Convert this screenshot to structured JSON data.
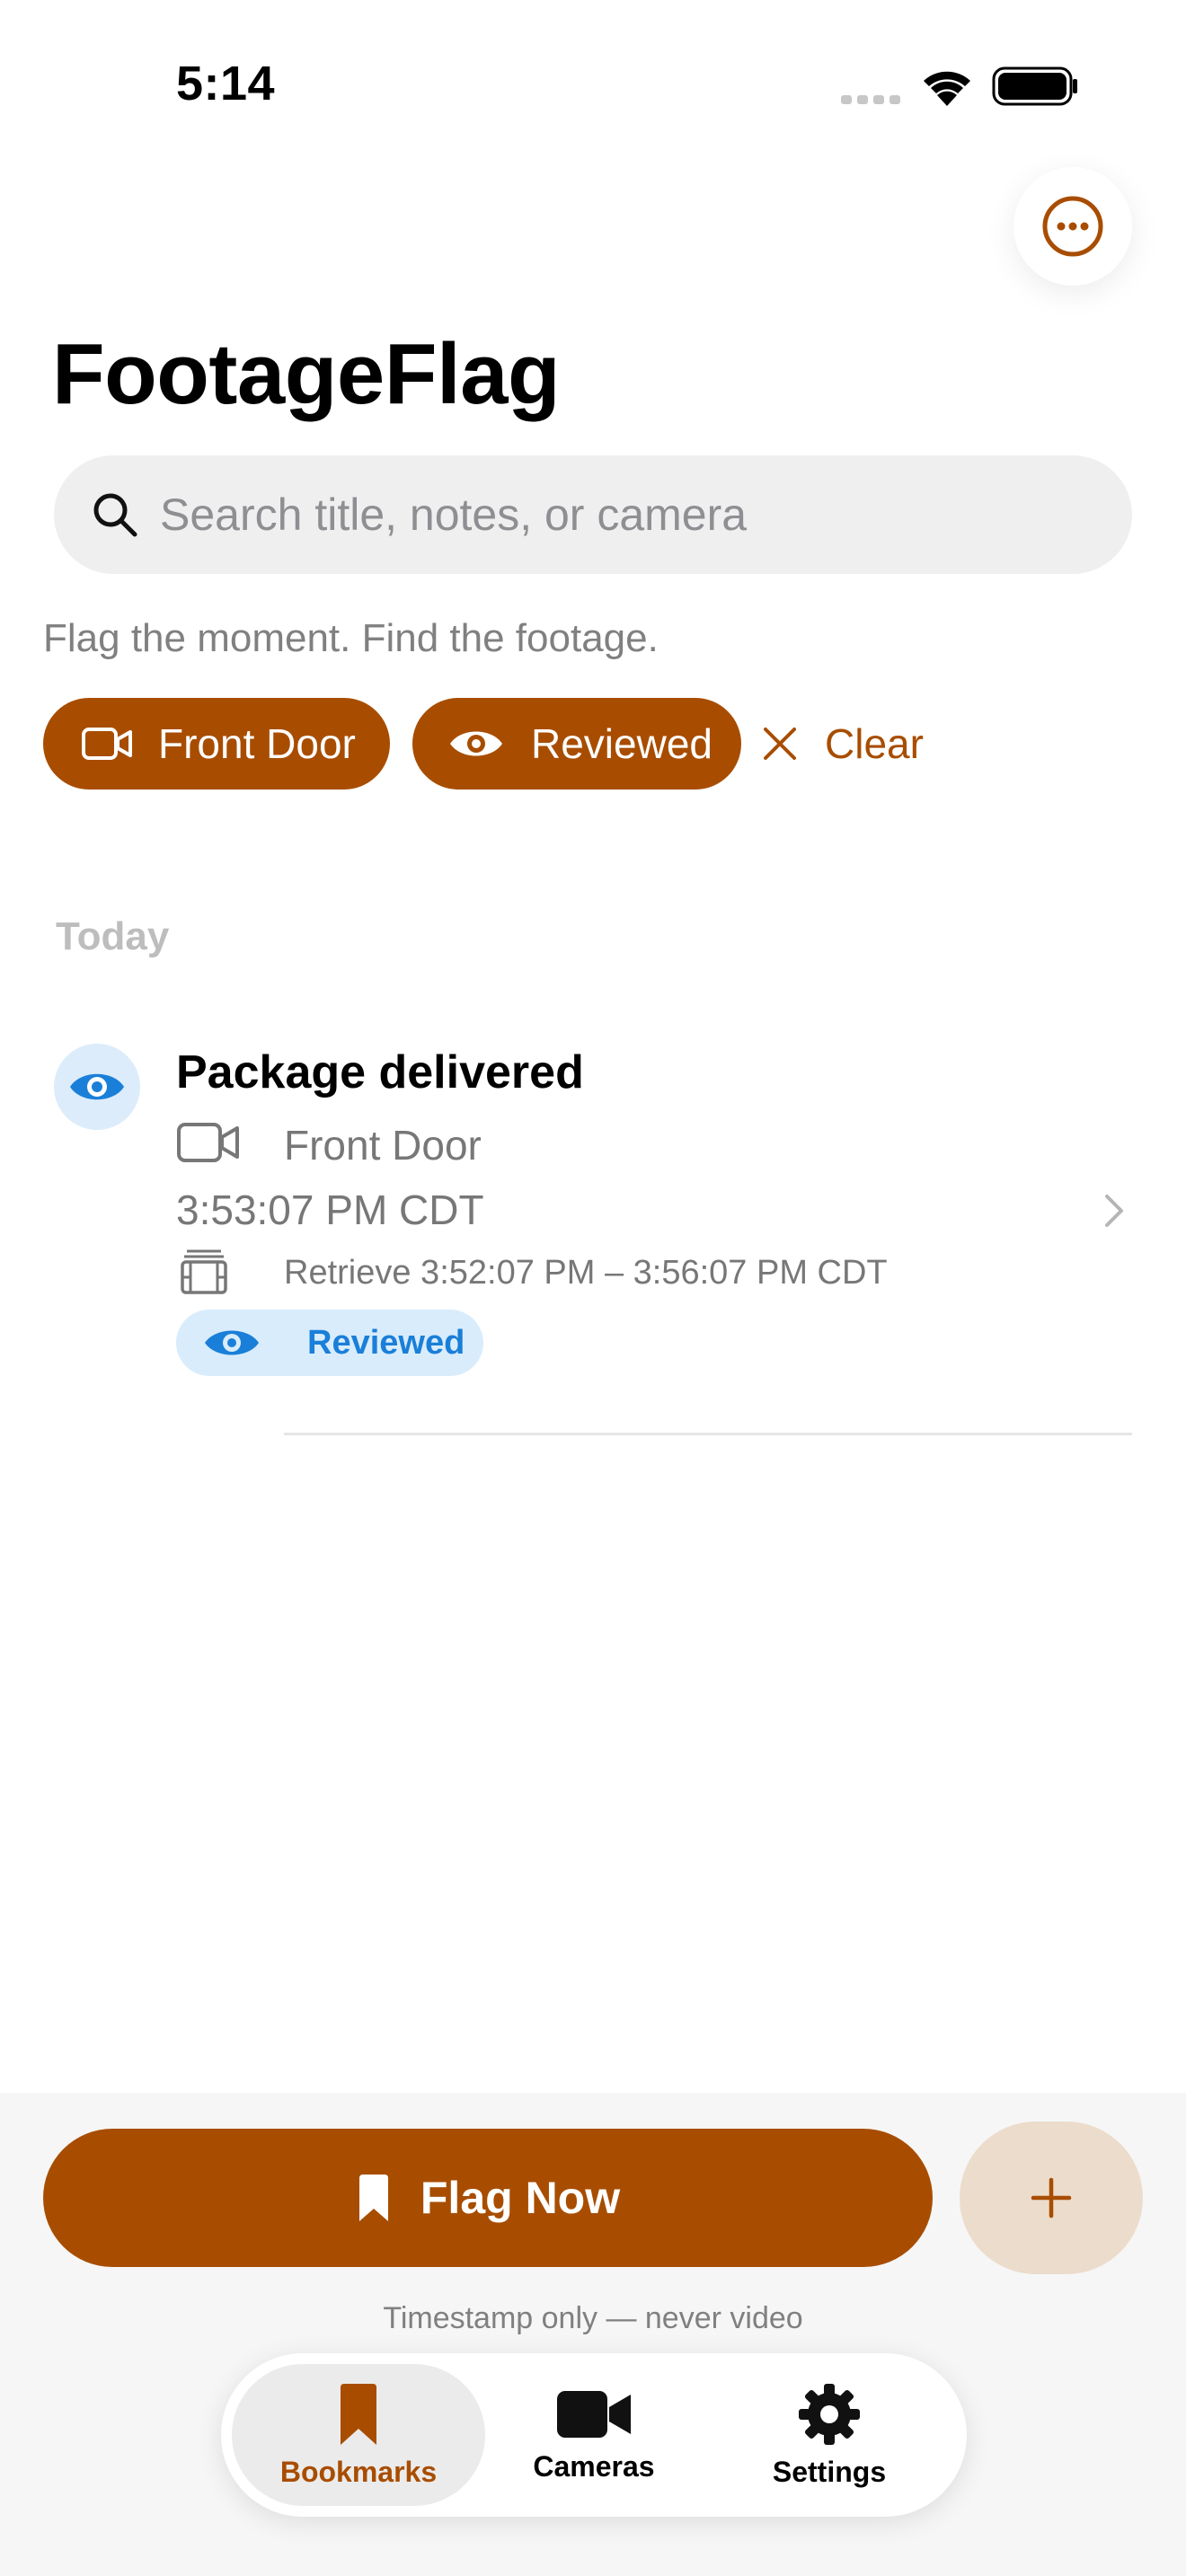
{
  "status_bar": {
    "time": "5:14"
  },
  "app": {
    "title": "FootageFlag",
    "tagline": "Flag the moment. Find the footage."
  },
  "search": {
    "placeholder": "Search title, notes, or camera",
    "value": ""
  },
  "filters": {
    "chips": [
      {
        "label": "Front Door",
        "icon": "video-camera-icon"
      },
      {
        "label": "Reviewed",
        "icon": "eye-icon"
      }
    ],
    "clear_label": "Clear"
  },
  "list": {
    "section_title": "Today",
    "items": [
      {
        "title": "Package delivered",
        "camera": "Front Door",
        "time": "3:53:07 PM CDT",
        "retrieve": "Retrieve 3:52:07 PM – 3:56:07 PM CDT",
        "status": "Reviewed",
        "status_icon": "eye-icon"
      }
    ]
  },
  "actions": {
    "flag_now_label": "Flag Now",
    "add_icon": "plus-icon",
    "footnote": "Timestamp only — never video"
  },
  "tabs": [
    {
      "label": "Bookmarks",
      "icon": "bookmark-icon",
      "active": true
    },
    {
      "label": "Cameras",
      "icon": "video-camera-icon",
      "active": false
    },
    {
      "label": "Settings",
      "icon": "gear-icon",
      "active": false
    }
  ],
  "colors": {
    "accent": "#a84d00",
    "accent_light": "#ecdccc",
    "reviewed_blue": "#1a7fd8",
    "reviewed_bg": "#d9ecfc"
  }
}
